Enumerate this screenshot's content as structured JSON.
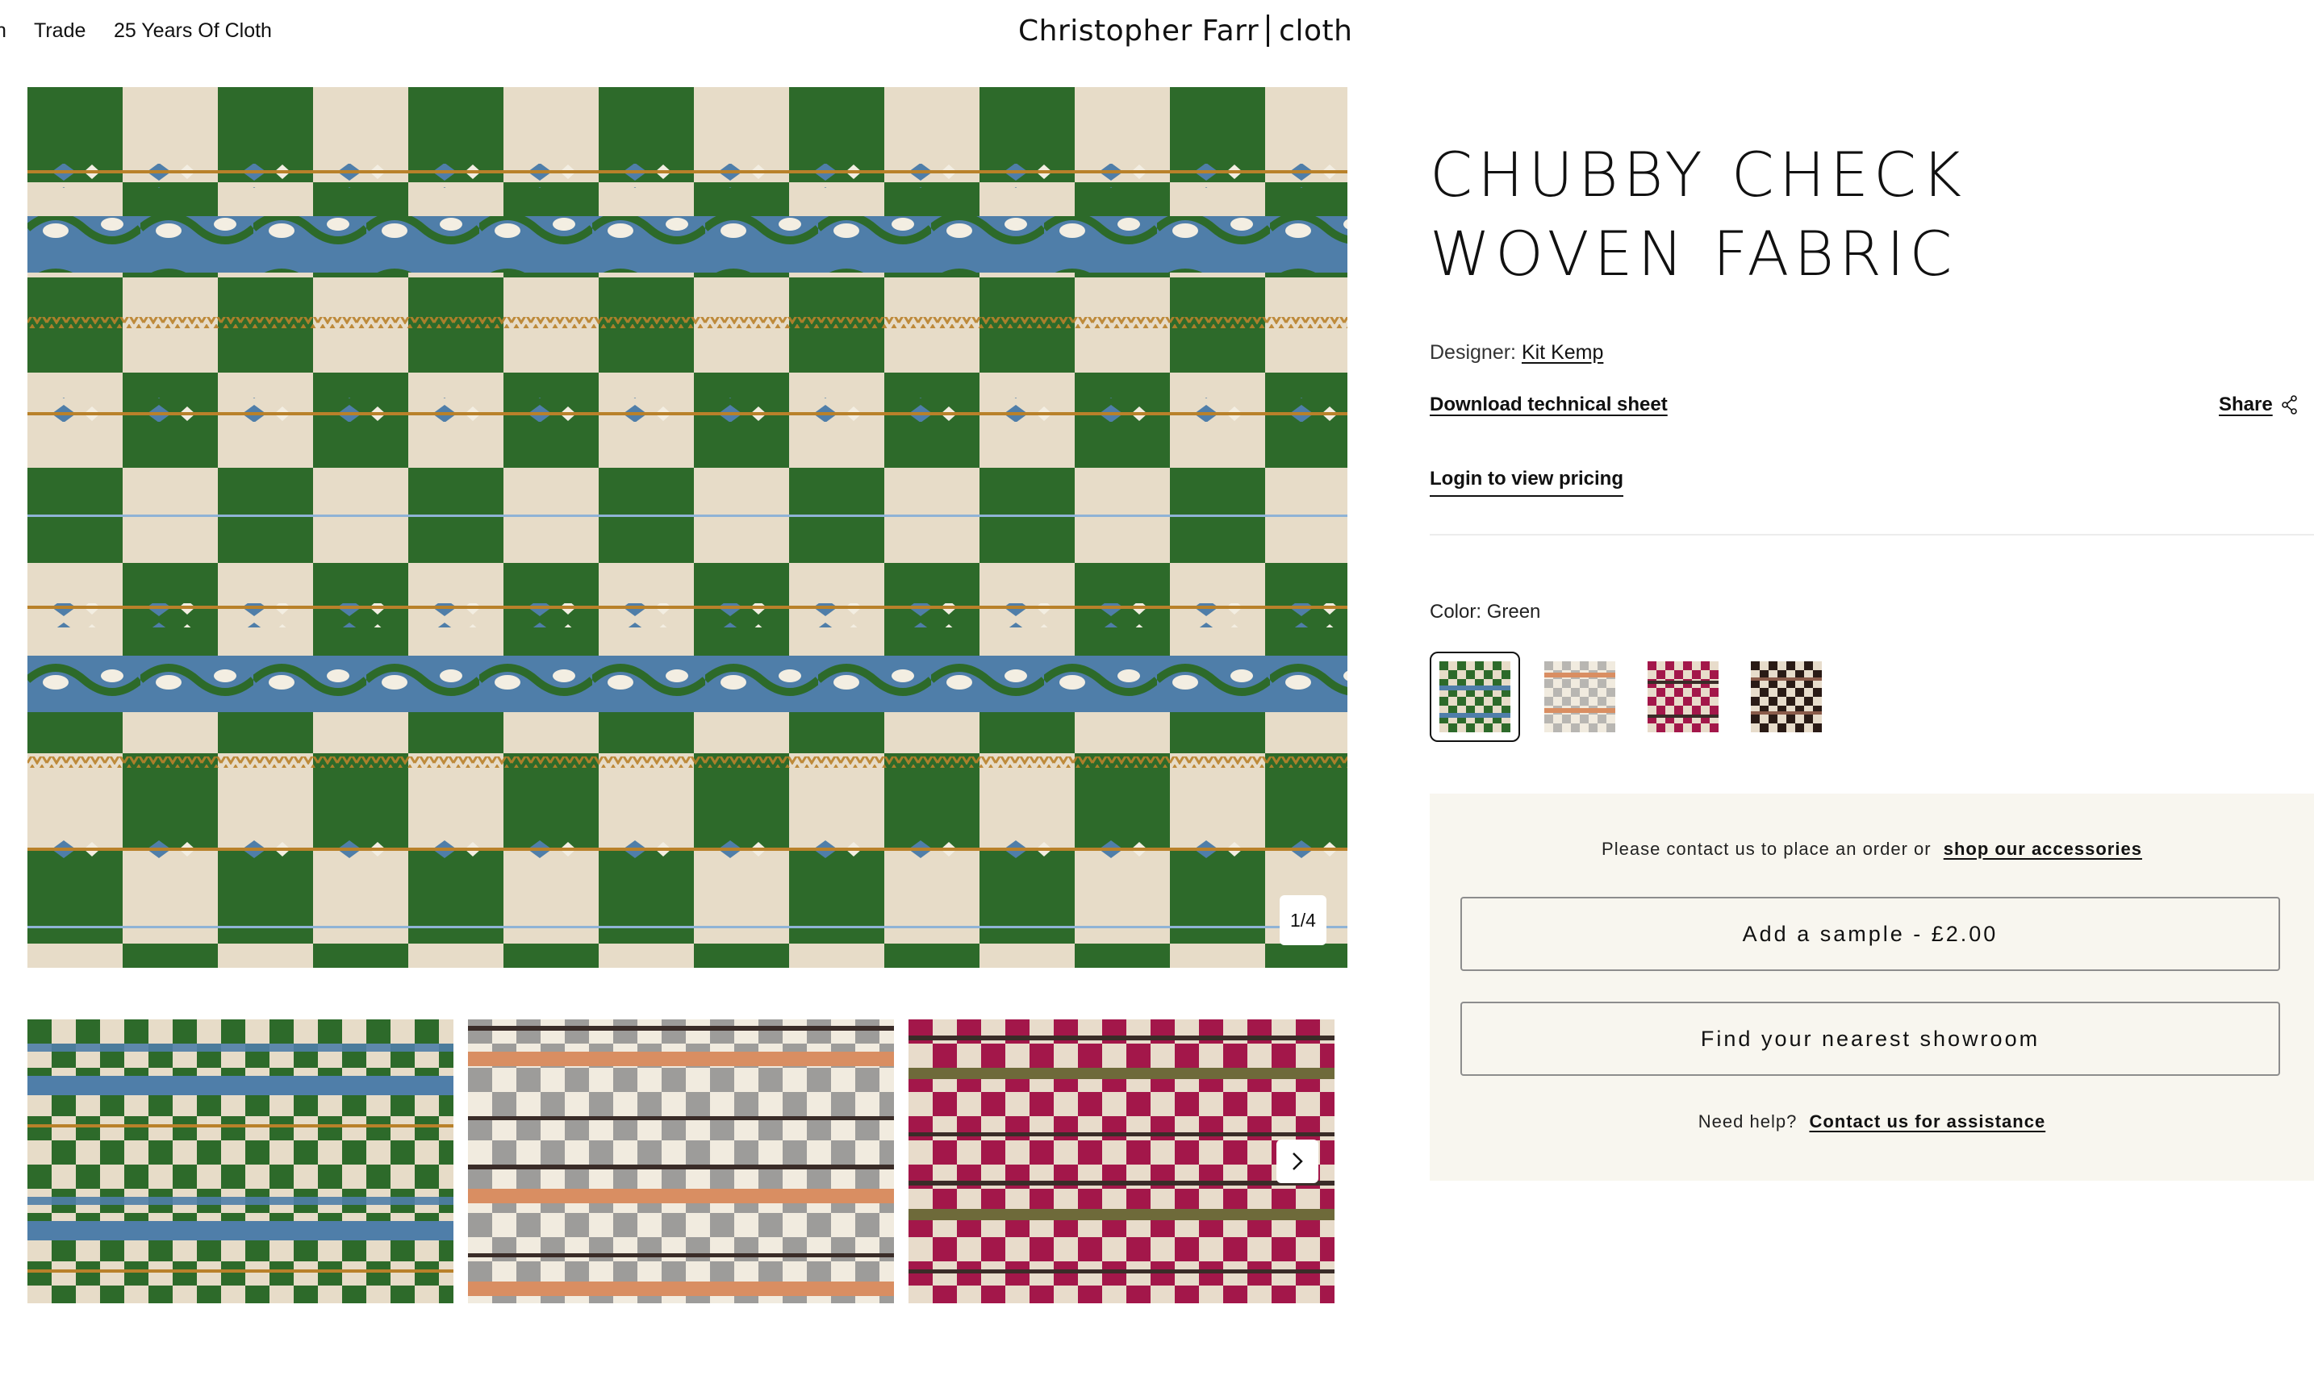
{
  "nav": {
    "cut_item": "n",
    "trade": "Trade",
    "years": "25 Years Of Cloth"
  },
  "brand": {
    "name": "Christopher Farr",
    "sub": "cloth"
  },
  "gallery": {
    "counter": "1/4",
    "thumbnails": [
      "green",
      "grey-orange",
      "red"
    ]
  },
  "product": {
    "title": "CHUBBY CHECK WOVEN FABRIC",
    "designer_label": "Designer:",
    "designer_name": "Kit Kemp",
    "download": "Download technical sheet",
    "share": "Share",
    "login": "Login to view pricing",
    "color_label": "Color: Green",
    "swatches": [
      {
        "name": "green",
        "selected": true,
        "colors": [
          "#2d6a2a",
          "#e7dcc8"
        ]
      },
      {
        "name": "grey-orange",
        "selected": false,
        "colors": [
          "#b8b6b2",
          "#d98e62"
        ]
      },
      {
        "name": "red",
        "selected": false,
        "colors": [
          "#a3174a",
          "#e8dccb"
        ]
      },
      {
        "name": "black",
        "selected": false,
        "colors": [
          "#2a1b16",
          "#e7dccb"
        ]
      }
    ]
  },
  "order": {
    "contact_text": "Please contact us to place an order or",
    "accessories_link": "shop our accessories",
    "sample_button": "Add a sample - £2.00",
    "showroom_button": "Find your nearest showroom",
    "help_text": "Need help?",
    "help_link": "Contact us for assistance"
  },
  "colors": {
    "panel_bg": "#f8f6ef",
    "green": "#2d6a2a",
    "cream": "#e7dcc8",
    "blue": "#4f7ea9",
    "ochre": "#b9812a"
  }
}
